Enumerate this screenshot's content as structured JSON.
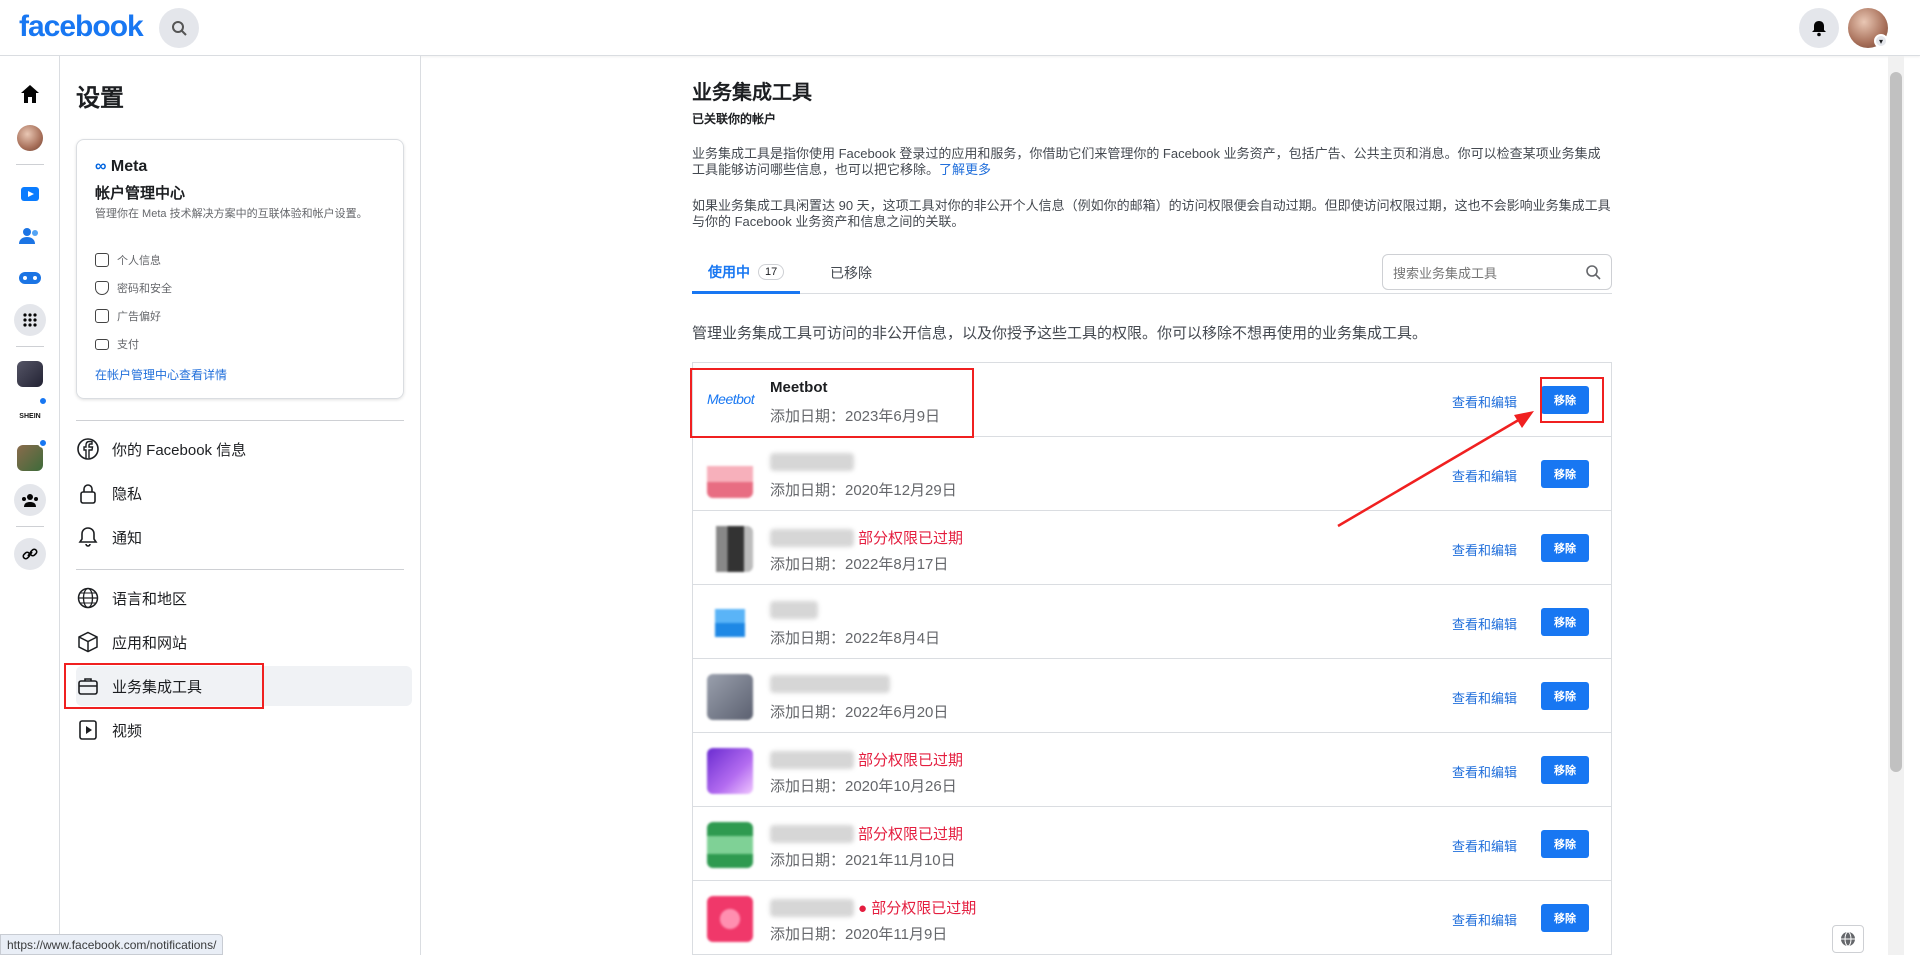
{
  "topbar": {
    "logo": "facebook"
  },
  "sidebar": {
    "title": "设置",
    "meta_card": {
      "logo_symbol": "∞",
      "logo": "Meta",
      "title": "帐户管理中心",
      "description": "管理你在 Meta 技术解决方案中的互联体验和帐户设置。",
      "items": [
        "个人信息",
        "密码和安全",
        "广告偏好",
        "支付"
      ],
      "link": "在帐户管理中心查看详情"
    },
    "nav": [
      {
        "label": "你的 Facebook 信息",
        "icon": "facebook-icon"
      },
      {
        "label": "隐私",
        "icon": "lock-icon"
      },
      {
        "label": "通知",
        "icon": "bell-icon"
      },
      {
        "label": "语言和地区",
        "icon": "globe-icon"
      },
      {
        "label": "应用和网站",
        "icon": "cube-icon"
      },
      {
        "label": "业务集成工具",
        "icon": "briefcase-icon"
      },
      {
        "label": "视频",
        "icon": "video-icon"
      }
    ]
  },
  "main": {
    "title": "业务集成工具",
    "subtitle": "已关联你的帐户",
    "para1": "业务集成工具是指你使用 Facebook 登录过的应用和服务，你借助它们来管理你的 Facebook 业务资产，包括广告、公共主页和消息。你可以检查某项业务集成工具能够访问哪些信息，也可以把它移除。",
    "learn_more": "了解更多",
    "para2": "如果业务集成工具闲置达 90 天，这项工具对你的非公开个人信息（例如你的邮箱）的访问权限便会自动过期。但即使访问权限过期，这也不会影响业务集成工具与你的 Facebook 业务资产和信息之间的关联。",
    "tabs": [
      {
        "label": "使用中",
        "count": "17"
      },
      {
        "label": "已移除"
      }
    ],
    "search_placeholder": "搜索业务集成工具",
    "intro": "管理业务集成工具可访问的非公开信息，以及你授予这些工具的权限。你可以移除不想再使用的业务集成工具。",
    "view_label": "查看和编辑",
    "remove_label": "移除",
    "apps": [
      {
        "name": "Meetbot",
        "logo": "Meetbot",
        "date": "添加日期：2023年6月9日",
        "expired": ""
      },
      {
        "name": "",
        "date": "添加日期：2020年12月29日",
        "expired": "",
        "color": "#f08a9a"
      },
      {
        "name": "",
        "date": "添加日期：2022年8月17日",
        "expired": "部分权限已过期",
        "color": "#666"
      },
      {
        "name": "",
        "date": "添加日期：2022年8月4日",
        "expired": "",
        "color": "#3aa0f0"
      },
      {
        "name": "",
        "date": "添加日期：2022年6月20日",
        "expired": "",
        "color": "#7d8394"
      },
      {
        "name": "",
        "date": "添加日期：2020年10月26日",
        "expired": "部分权限已过期",
        "color": "#8a4cd8"
      },
      {
        "name": "",
        "date": "添加日期：2021年11月10日",
        "expired": "部分权限已过期",
        "color": "#3faa60"
      },
      {
        "name": "",
        "date": "添加日期：2020年11月9日",
        "expired": "部分权限已过期",
        "color": "#f0386a"
      }
    ]
  },
  "status_url": "https://www.facebook.com/notifications/"
}
